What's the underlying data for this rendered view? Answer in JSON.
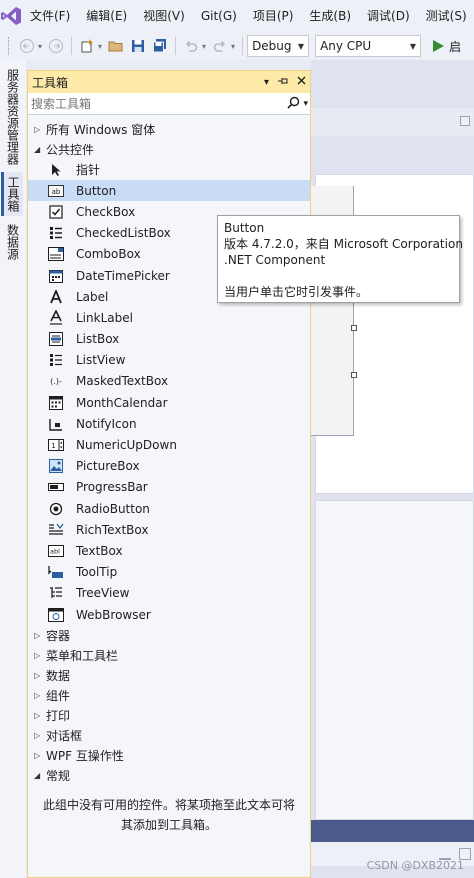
{
  "menu": [
    "文件(F)",
    "编辑(E)",
    "视图(V)",
    "Git(G)",
    "项目(P)",
    "生成(B)",
    "调试(D)",
    "测试(S)"
  ],
  "toolbar": {
    "config": "Debug",
    "platform": "Any CPU"
  },
  "side_tabs": [
    "服务器资源管理器",
    "工具箱",
    "数据源"
  ],
  "toolbox": {
    "title": "工具箱",
    "search_placeholder": "搜索工具箱",
    "group_all": "所有 Windows 窗体",
    "group_common": "公共控件",
    "items": [
      {
        "label": "指针",
        "icon": "pointer-icon"
      },
      {
        "label": "Button",
        "icon": "button-icon"
      },
      {
        "label": "CheckBox",
        "icon": "checkbox-icon"
      },
      {
        "label": "CheckedListBox",
        "icon": "checkedlistbox-icon"
      },
      {
        "label": "ComboBox",
        "icon": "combobox-icon"
      },
      {
        "label": "DateTimePicker",
        "icon": "datetimepicker-icon"
      },
      {
        "label": "Label",
        "icon": "label-icon"
      },
      {
        "label": "LinkLabel",
        "icon": "linklabel-icon"
      },
      {
        "label": "ListBox",
        "icon": "listbox-icon"
      },
      {
        "label": "ListView",
        "icon": "listview-icon"
      },
      {
        "label": "MaskedTextBox",
        "icon": "maskedtextbox-icon"
      },
      {
        "label": "MonthCalendar",
        "icon": "monthcalendar-icon"
      },
      {
        "label": "NotifyIcon",
        "icon": "notifyicon-icon"
      },
      {
        "label": "NumericUpDown",
        "icon": "numericupdown-icon"
      },
      {
        "label": "PictureBox",
        "icon": "picturebox-icon"
      },
      {
        "label": "ProgressBar",
        "icon": "progressbar-icon"
      },
      {
        "label": "RadioButton",
        "icon": "radiobutton-icon"
      },
      {
        "label": "RichTextBox",
        "icon": "richtextbox-icon"
      },
      {
        "label": "TextBox",
        "icon": "textbox-icon"
      },
      {
        "label": "ToolTip",
        "icon": "tooltip-icon"
      },
      {
        "label": "TreeView",
        "icon": "treeview-icon"
      },
      {
        "label": "WebBrowser",
        "icon": "webbrowser-icon"
      }
    ],
    "collapsed_groups": [
      "容器",
      "菜单和工具栏",
      "数据",
      "组件",
      "打印",
      "对话框",
      "WPF 互操作性"
    ],
    "group_general": "常规",
    "empty_message": "此组中没有可用的控件。将某项拖至此文本可将其添加到工具箱。"
  },
  "tooltip": {
    "title": "Button",
    "version": "版本 4.7.2.0，来自 Microsoft Corporation",
    "component": ".NET Component",
    "description": "当用户单击它时引发事件。"
  },
  "watermark": "CSDN @DXB2021",
  "colors": {
    "accent": "#2d5f9e",
    "header": "#fde9a8",
    "selection": "#c9dcf5",
    "vs_purple": "#865fc5"
  }
}
